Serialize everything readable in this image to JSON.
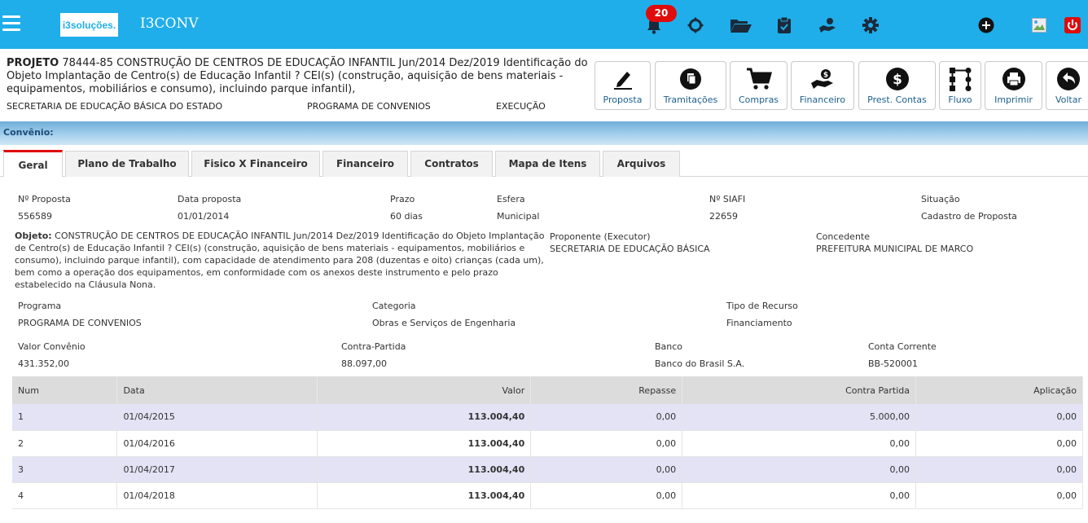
{
  "navbar": {
    "logo_text": "i3soluções.",
    "app_title": "I3CONV",
    "notification_count": "20",
    "accent_color": "#1faee9",
    "badge_color": "#e00b0b"
  },
  "project": {
    "label": "PROJETO",
    "text": "78444-85 CONSTRUÇÃO DE CENTROS DE EDUCAÇÃO INFANTIL Jun/2014 Dez/2019 Identificação do Objeto Implantação de Centro(s) de Educação Infantil ? CEI(s) (construção, aquisição de bens materiais - equipamentos, mobiliários e consumo), incluindo parque infantil),",
    "secretaria": "SECRETARIA DE EDUCAÇÃO BÁSICA DO ESTADO",
    "programa": "PROGRAMA DE CONVENIOS",
    "status": "EXECUÇÃO"
  },
  "actions": [
    {
      "label": "Proposta",
      "icon": "pen-icon"
    },
    {
      "label": "Tramitações",
      "icon": "copy-icon"
    },
    {
      "label": "Compras",
      "icon": "cart-icon"
    },
    {
      "label": "Financeiro",
      "icon": "hand-money-icon"
    },
    {
      "label": "Prest. Contas",
      "icon": "dollar-icon"
    },
    {
      "label": "Fluxo",
      "icon": "flow-icon"
    },
    {
      "label": "Imprimir",
      "icon": "printer-icon"
    },
    {
      "label": "Voltar",
      "icon": "back-icon"
    }
  ],
  "convenio_bar": "Convênio:",
  "tabs": [
    "Geral",
    "Plano de Trabalho",
    "Fisico X Financeiro",
    "Financeiro",
    "Contratos",
    "Mapa de Itens",
    "Arquivos"
  ],
  "details": {
    "n_proposta_label": "Nº Proposta",
    "n_proposta": "556589",
    "data_proposta_label": "Data proposta",
    "data_proposta": "01/01/2014",
    "prazo_label": "Prazo",
    "prazo": "60 dias",
    "esfera_label": "Esfera",
    "esfera": "Municipal",
    "siafi_label": "Nº SIAFI",
    "siafi": "22659",
    "situacao_label": "Situação",
    "situacao": "Cadastro de Proposta",
    "objeto_label": "Objeto:",
    "objeto": "CONSTRUÇÃO DE CENTROS DE EDUCAÇÃO INFANTIL Jun/2014 Dez/2019 Identificação do Objeto Implantação de Centro(s) de Educação Infantil ? CEI(s) (construção, aquisição de bens materiais - equipamentos, mobiliários e consumo), incluindo parque infantil), com capacidade de atendimento para 208 (duzentas e oito) crianças (cada um), bem como a operação dos equipamentos, em conformidade com os anexos deste instrumento e pelo prazo estabelecido na Cláusula Nona.",
    "proponente_label": "Proponente (Executor)",
    "proponente": "SECRETARIA DE EDUCAÇÃO BÁSICA",
    "concedente_label": "Concedente",
    "concedente": "PREFEITURA MUNICIPAL DE MARCO",
    "programa_label": "Programa",
    "programa": "PROGRAMA DE CONVENIOS",
    "categoria_label": "Categoria",
    "categoria": "Obras e Serviços de Engenharia",
    "tipo_recurso_label": "Tipo de Recurso",
    "tipo_recurso": "Financiamento",
    "valor_label": "Valor Convênio",
    "valor": "431.352,00",
    "contra_label": "Contra-Partida",
    "contra": "88.097,00",
    "banco_label": "Banco",
    "banco": "Banco do Brasil S.A.",
    "conta_label": "Conta Corrente",
    "conta": "BB-520001"
  },
  "table": {
    "headers": [
      "Num",
      "Data",
      "Valor",
      "Repasse",
      "Contra Partida",
      "Aplicação"
    ],
    "rows": [
      [
        "1",
        "01/04/2015",
        "113.004,40",
        "0,00",
        "5.000,00",
        "0,00"
      ],
      [
        "2",
        "01/04/2016",
        "113.004,40",
        "0,00",
        "0,00",
        "0,00"
      ],
      [
        "3",
        "01/04/2017",
        "113.004,40",
        "0,00",
        "0,00",
        "0,00"
      ],
      [
        "4",
        "01/04/2018",
        "113.004,40",
        "0,00",
        "0,00",
        "0,00"
      ]
    ]
  }
}
